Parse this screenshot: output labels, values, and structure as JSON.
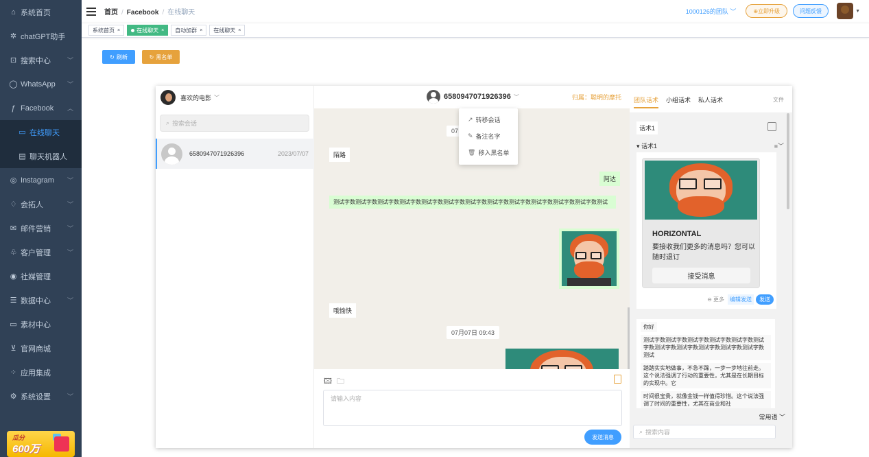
{
  "sidebar": {
    "items": [
      {
        "label": "系统首页",
        "icon": "home-icon",
        "arrow": false
      },
      {
        "label": "chatGPT助手",
        "icon": "openai-icon",
        "arrow": false
      },
      {
        "label": "搜索中心",
        "icon": "search-box-icon",
        "arrow": true
      },
      {
        "label": "WhatsApp",
        "icon": "whatsapp-icon",
        "arrow": true
      },
      {
        "label": "Facebook",
        "icon": "facebook-icon",
        "arrow": true,
        "expanded": true
      },
      {
        "label": "在线聊天",
        "icon": "chat-icon",
        "sub": true,
        "active": true
      },
      {
        "label": "聊天机器人",
        "icon": "robot-icon",
        "sub": true
      },
      {
        "label": "Instagram",
        "icon": "instagram-icon",
        "arrow": true
      },
      {
        "label": "会拓人",
        "icon": "bulb-icon",
        "arrow": true
      },
      {
        "label": "邮件营销",
        "icon": "mail-icon",
        "arrow": true
      },
      {
        "label": "客户管理",
        "icon": "users-icon",
        "arrow": true
      },
      {
        "label": "社媒管理",
        "icon": "social-icon",
        "arrow": false
      },
      {
        "label": "数据中心",
        "icon": "database-icon",
        "arrow": true
      },
      {
        "label": "素材中心",
        "icon": "folder-icon",
        "arrow": false
      },
      {
        "label": "官网商城",
        "icon": "cart-icon",
        "arrow": false
      },
      {
        "label": "应用集成",
        "icon": "apps-icon",
        "arrow": false
      },
      {
        "label": "系统设置",
        "icon": "settings-icon",
        "arrow": true
      }
    ],
    "promo": {
      "line1": "瓜分",
      "line2": "600万"
    }
  },
  "topbar": {
    "breadcrumb": [
      "首页",
      "Facebook",
      "在线聊天"
    ],
    "team": "1000126的团队",
    "upgrade": "⊕立即升级",
    "feedback": "问题反馈"
  },
  "tags": [
    {
      "label": "系统首页",
      "active": false
    },
    {
      "label": "在线聊天",
      "active": true
    },
    {
      "label": "自动加群",
      "active": false
    },
    {
      "label": "在线聊天",
      "active": false
    }
  ],
  "actions": {
    "refresh": "刷新",
    "blacklist": "黑名单"
  },
  "left": {
    "account": "喜欢的电影",
    "search_placeholder": "搜索会话",
    "conversation": {
      "number": "6580947071926396",
      "date": "2023/07/07"
    }
  },
  "chat": {
    "contact": "6580947071926396",
    "owner": "归属：聪明的摩托",
    "time1": "07",
    "msg_stranger": "陌路",
    "msg_ada": "阿达",
    "msg_long": "测试字数测试字数测试字数测试字数测试字数测试字数测试字数测试字数测试字数测试字数测试字数测试字数测试",
    "msg_happy": "哦愉快",
    "time2": "07月07日 09:43",
    "input_placeholder": "请输入内容",
    "send": "发送消息"
  },
  "context_menu": {
    "items": [
      {
        "icon": "↗",
        "label": "转移会话"
      },
      {
        "icon": "✎",
        "label": "备注名字"
      },
      {
        "icon": "🗑",
        "label": "移入黑名单"
      }
    ]
  },
  "right": {
    "tabs": [
      "团队话术",
      "小组话术",
      "私人话术"
    ],
    "file": "文件",
    "script_tag": "话术1",
    "group": "▾ 话术1",
    "card": {
      "title": "HORIZONTAL",
      "body": "要接收我们更多的消息吗？您可以随时退订",
      "accept": "接受消息"
    },
    "more": "⊖ 更多",
    "edit_send": "编辑发送",
    "send": "发送",
    "phrases": [
      "你好",
      "测试字数测试字数测试字数测试字数测试字数测试字数测试字数测试字数测试字数测试字数测试字数测试",
      "踏踏实实地做事，不急不躁，一步一步地往前走。这个说法强调了行动的重要性，尤其是在长期目标的实现中。它",
      "时间很宝贵，就像金钱一样值得珍惜。这个说法强调了时间的重要性，尤其在商业和社"
    ],
    "common": "常用语 ﹀",
    "search_placeholder": "搜索内容"
  }
}
